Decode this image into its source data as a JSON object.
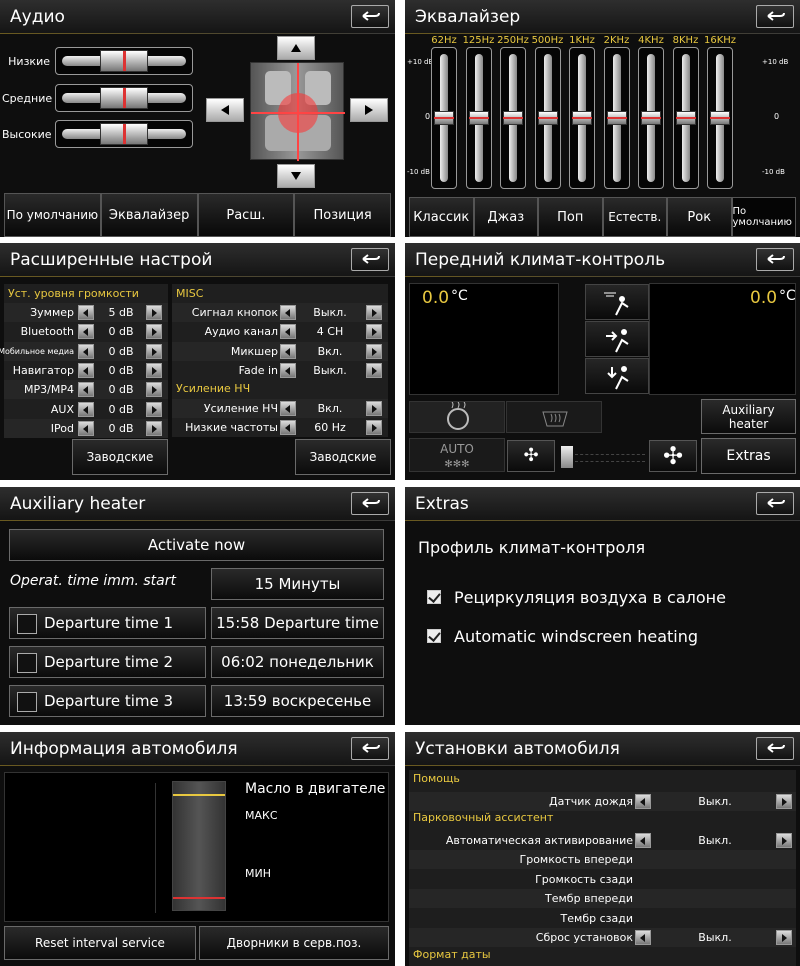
{
  "audio": {
    "title": "Аудио",
    "labels": [
      "Низкие",
      "Средние",
      "Высокие"
    ],
    "buttons": [
      "По умолчанию",
      "Эквалайзер",
      "Расш.",
      "Позиция"
    ]
  },
  "eq": {
    "title": "Эквалайзер",
    "bands": [
      "62Hz",
      "125Hz",
      "250Hz",
      "500Hz",
      "1KHz",
      "2KHz",
      "4KHz",
      "8KHz",
      "16KHz"
    ],
    "scale_top": "+10 dB",
    "scale_mid": "0",
    "scale_bot": "-10 dB",
    "presets": [
      "Классик",
      "Джаз",
      "Поп",
      "Естеств.",
      "Рок",
      "По умолчанию"
    ]
  },
  "ext": {
    "title": "Расширенные настрой",
    "left_header": "Уст. уровня  громкости",
    "right_header": "MISC",
    "left_rows": [
      {
        "label": "Зуммер",
        "value": "5 dB"
      },
      {
        "label": "Bluetooth",
        "value": "0 dB"
      },
      {
        "label": "Мобильное медиа",
        "value": "0 dB"
      },
      {
        "label": "Навигатор",
        "value": "0 dB"
      },
      {
        "label": "MP3/MP4",
        "value": "0 dB"
      },
      {
        "label": "AUX",
        "value": "0 dB"
      },
      {
        "label": "IPod",
        "value": "0 dB"
      }
    ],
    "right_rows": [
      {
        "label": "Сигнал кнопок",
        "value": "Выкл."
      },
      {
        "label": "Аудио канал",
        "value": "4 CH"
      },
      {
        "label": "Микшер",
        "value": "Вкл."
      },
      {
        "label": "Fade in",
        "value": "Выкл."
      }
    ],
    "bass_header": "Усиление НЧ",
    "bass_rows": [
      {
        "label": "Усиление НЧ",
        "value": "Вкл."
      },
      {
        "label": "Низкие частоты",
        "value": "60 Hz"
      }
    ],
    "factory": "Заводские"
  },
  "climate": {
    "title": "Передний климат-контроль",
    "left_temp": "0.0",
    "right_temp": "0.0",
    "unit": "°C",
    "aux": "Auxiliary heater",
    "auto": "AUTO",
    "extras": "Extras"
  },
  "auxheater": {
    "title": "Auxiliary heater",
    "activate": "Activate now",
    "op_label": "Operat. time imm. start",
    "op_value": "15 Минуты",
    "rows": [
      {
        "label": "Departure time 1",
        "value": "15:58  Departure time"
      },
      {
        "label": "Departure time 2",
        "value": "06:02  понедельник"
      },
      {
        "label": "Departure time 3",
        "value": "13:59  воскресенье"
      }
    ]
  },
  "extras": {
    "title": "Extras",
    "heading": "Профиль климат-контроля",
    "options": [
      "Рециркуляция воздуха в салоне",
      "Automatic windscreen heating"
    ]
  },
  "carinfo": {
    "title": "Информация автомобиля",
    "oil": "Масло в двигателе",
    "max": "МАКС",
    "min": "МИН",
    "btn1": "Reset interval service",
    "btn2": "Дворники в серв.поз."
  },
  "carset": {
    "title": "Установки автомобиля",
    "sections": [
      {
        "header": "Помощь",
        "rows": [
          {
            "label": "Датчик дождя",
            "value": "Выкл.",
            "arrows": true
          }
        ]
      },
      {
        "header": "Парковочный ассистент",
        "rows": [
          {
            "label": "Автоматическая активирование",
            "value": "Выкл.",
            "arrows": true
          },
          {
            "label": "Громкость впереди",
            "value": "",
            "arrows": false
          },
          {
            "label": "Громкость сзади",
            "value": "",
            "arrows": false
          },
          {
            "label": "Тембр впереди",
            "value": "",
            "arrows": false
          },
          {
            "label": "Тембр сзади",
            "value": "",
            "arrows": false
          },
          {
            "label": "Сброс установок",
            "value": "Выкл.",
            "arrows": true
          }
        ]
      },
      {
        "header": "Формат даты",
        "rows": []
      }
    ]
  },
  "eq_levels": [
    0,
    0,
    0,
    0,
    0,
    0,
    0,
    0,
    0
  ],
  "audio_levels": [
    0.5,
    0.5,
    0.5
  ]
}
